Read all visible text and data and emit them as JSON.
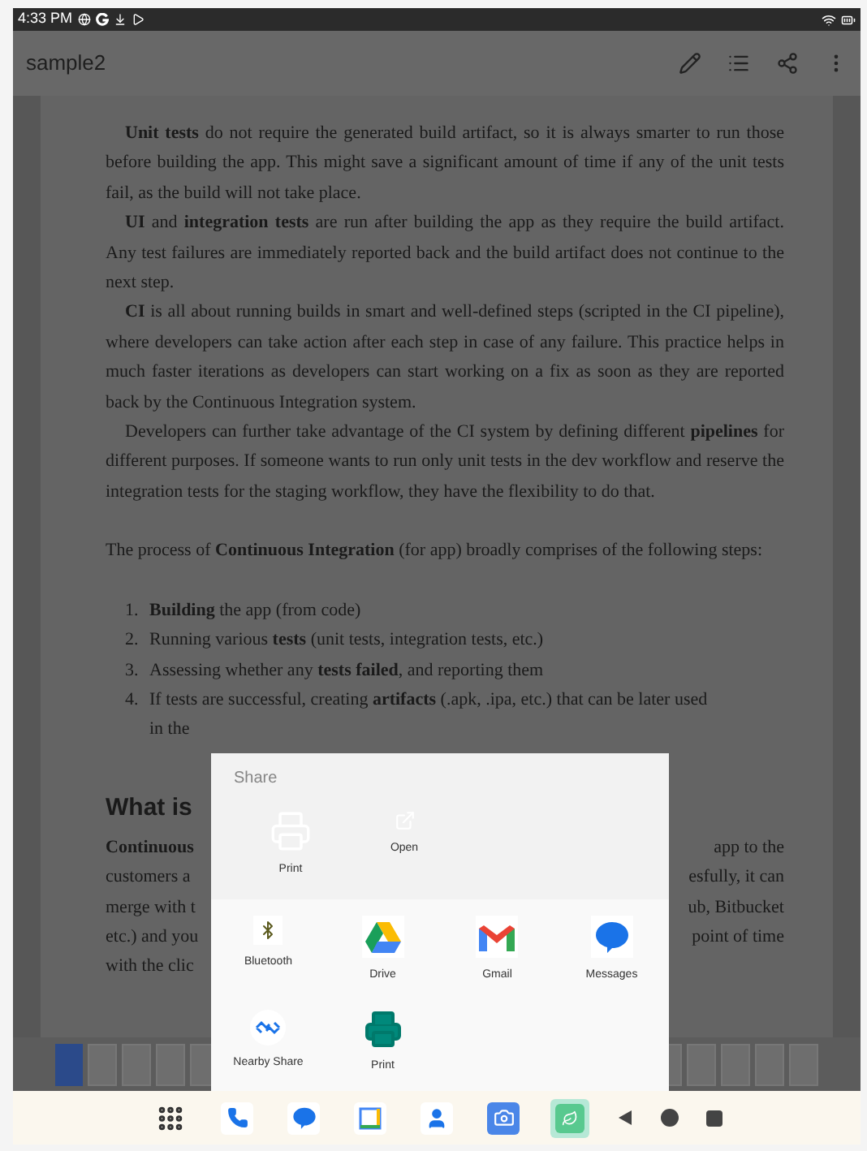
{
  "status_bar": {
    "time": "4:33 PM"
  },
  "app_bar": {
    "title": "sample2"
  },
  "document": {
    "paragraphs": [
      "**Unit tests** do not require the generated build artifact, so it is always smarter to run those before building the app. This might save a significant amount of time if any of the unit tests fail, as the build will not take place.",
      "**UI** and **integration tests** are run after building the app as they require the build artifact. Any test failures are immediately reported back and the build artifact does not continue to the next step.",
      "**CI** is all about running builds in smart and well-defined steps (scripted in the CI pipeline), where developers can take action after each step in case of any failure. This practice helps in much faster iterations as developers can start working on a fix as soon as they are reported back by the Continuous Integration system.",
      "Developers can further take advantage of the CI system by defining different **pipelines** for different purposes. If someone wants to run only unit tests in the dev workflow and reserve the integration tests for the staging workflow, they have the flexibility to do that."
    ],
    "intro": "The process of **Continuous Integration** (for app) broadly comprises of the following steps:",
    "steps": [
      {
        "number": "1.",
        "text": "**Building** the app (from code)"
      },
      {
        "number": "2.",
        "text": "Running various **tests** (unit tests, integration tests, etc.)"
      },
      {
        "number": "3.",
        "text": "Assessing whether any **tests failed**, and reporting them"
      },
      {
        "number": "4.",
        "text": "If tests are successful, creating **artifacts** (.apk, .ipa, etc.) that can be later used",
        "continuation": "in the"
      }
    ],
    "heading": "What is",
    "covered_lines": [
      {
        "left": "**Continuous**",
        "right": "app to the"
      },
      {
        "left": "customers a",
        "right": "esfully, it can"
      },
      {
        "left": "merge with t",
        "right": "ub, Bitbucket"
      },
      {
        "left": "etc.) and you",
        "right": "point of time"
      },
      {
        "left": "with the clic"
      }
    ]
  },
  "share_sheet": {
    "title": "Share",
    "actions": [
      {
        "kind": "print",
        "label": "Print"
      },
      {
        "kind": "open",
        "label": "Open"
      }
    ],
    "apps": [
      {
        "kind": "bluetooth",
        "label": "Bluetooth"
      },
      {
        "kind": "drive",
        "label": "Drive"
      },
      {
        "kind": "gmail",
        "label": "Gmail"
      },
      {
        "kind": "messages",
        "label": "Messages"
      },
      {
        "kind": "nearby",
        "label": "Nearby Share"
      },
      {
        "kind": "print",
        "label": "Print"
      }
    ]
  },
  "dock": [
    {
      "kind": "apps",
      "selected": false
    },
    {
      "kind": "phone",
      "selected": false
    },
    {
      "kind": "messages",
      "selected": false
    },
    {
      "kind": "calendar",
      "selected": false
    },
    {
      "kind": "contacts",
      "selected": false
    },
    {
      "kind": "camera",
      "selected": false
    },
    {
      "kind": "app",
      "selected": true
    }
  ]
}
